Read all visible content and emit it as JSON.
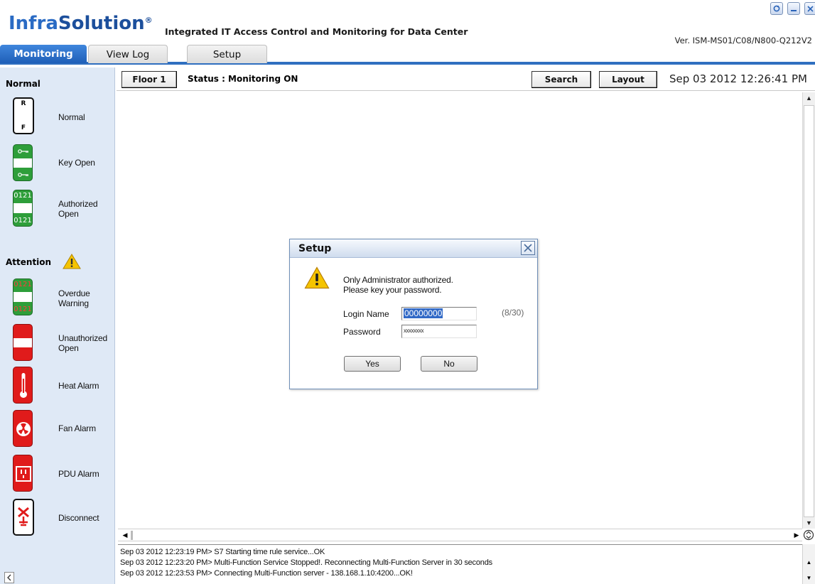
{
  "app": {
    "logo_prefix": "Infra",
    "logo_suffix": "Solution",
    "logo_mark": "®",
    "tagline": "Integrated IT Access Control and Monitoring for Data Center",
    "version": "Ver. ISM-MS01/C08/N800-Q212V2"
  },
  "window_controls": [
    "refresh-icon",
    "minimize-icon",
    "close-icon"
  ],
  "tabs": [
    {
      "label": "Monitoring",
      "active": true
    },
    {
      "label": "View Log",
      "active": false
    },
    {
      "label": "Setup",
      "active": false
    }
  ],
  "toolbar": {
    "floor_label": "Floor 1",
    "status": "Status : Monitoring ON",
    "search_label": "Search",
    "layout_label": "Layout",
    "datetime": "Sep 03 2012  12:26:41 PM"
  },
  "sidebar": {
    "normal_heading": "Normal",
    "attention_heading": "Attention",
    "normal_items": [
      {
        "label": "Normal",
        "icon": "rack-normal-icon",
        "glyph_top": "R",
        "glyph_bottom": "F"
      },
      {
        "label": "Key Open",
        "icon": "key-open-icon"
      },
      {
        "label": "Authorized Open",
        "line1": "Authorized",
        "line2": "Open",
        "icon": "authorized-open-icon",
        "code": "0121"
      }
    ],
    "attention_items": [
      {
        "label": "Overdue Warning",
        "line1": "Overdue",
        "line2": "Warning",
        "icon": "overdue-warning-icon",
        "code": "0121"
      },
      {
        "label": "Unauthorized Open",
        "line1": "Unauthorized",
        "line2": "Open",
        "icon": "unauthorized-open-icon"
      },
      {
        "label": "Heat Alarm",
        "icon": "heat-alarm-icon"
      },
      {
        "label": "Fan Alarm",
        "icon": "fan-alarm-icon"
      },
      {
        "label": "PDU Alarm",
        "icon": "pdu-alarm-icon"
      },
      {
        "label": "Disconnect",
        "icon": "disconnect-icon"
      }
    ]
  },
  "log": [
    "Sep 03 2012   12:23:19 PM>  S7 Starting time rule service...OK",
    "Sep 03 2012   12:23:20 PM>  Multi-Function Service Stopped!. Reconnecting Multi-Function Server in 30 seconds",
    "Sep 03 2012   12:23:53 PM>  Connecting Multi-Function server - 138.168.1.10:4200...OK!"
  ],
  "dialog": {
    "title": "Setup",
    "message_line1": "Only Administrator authorized.",
    "message_line2": "Please key your password.",
    "login_label": "Login Name",
    "login_value": "00000000",
    "password_label": "Password",
    "password_value": "xxxxxxxx",
    "counter": "(8/30)",
    "yes_label": "Yes",
    "no_label": "No"
  },
  "colors": {
    "accent_blue": "#2f6fc0",
    "sidebar_bg": "#dfe9f6",
    "status_green": "#2e9e3a",
    "alarm_red": "#e01b1b",
    "warning_yellow": "#f5c400"
  }
}
